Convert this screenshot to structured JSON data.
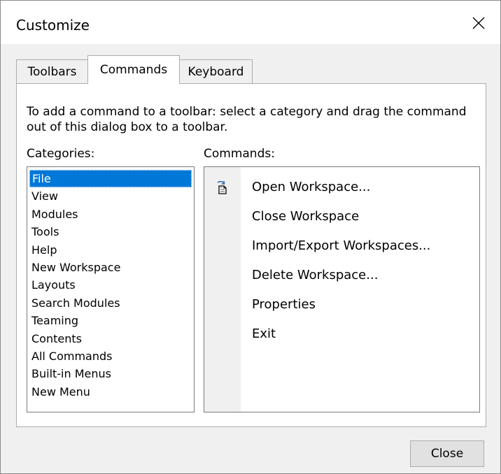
{
  "window": {
    "title": "Customize"
  },
  "tabs": [
    {
      "label": "Toolbars",
      "active": false
    },
    {
      "label": "Commands",
      "active": true
    },
    {
      "label": "Keyboard",
      "active": false
    }
  ],
  "instructions": "To add a command to a toolbar: select a category and drag the command out of this dialog box to a toolbar.",
  "categories": {
    "label": "Categories:",
    "selected": "File",
    "items": [
      "File",
      "View",
      "Modules",
      "Tools",
      "Help",
      "New Workspace",
      "Layouts",
      "Search Modules",
      "Teaming",
      "Contents",
      "All Commands",
      "Built-in Menus",
      "New Menu"
    ]
  },
  "commands": {
    "label": "Commands:",
    "items": [
      {
        "label": "Open Workspace...",
        "icon": "open-workspace-icon"
      },
      {
        "label": "Close Workspace",
        "icon": null
      },
      {
        "label": "Import/Export Workspaces...",
        "icon": null
      },
      {
        "label": "Delete Workspace...",
        "icon": null
      },
      {
        "label": "Properties",
        "icon": null
      },
      {
        "label": "Exit",
        "icon": null
      }
    ]
  },
  "buttons": {
    "close_label": "Close"
  },
  "colors": {
    "selection": "#0078d7",
    "dialog_bg": "#f0f0f0"
  }
}
